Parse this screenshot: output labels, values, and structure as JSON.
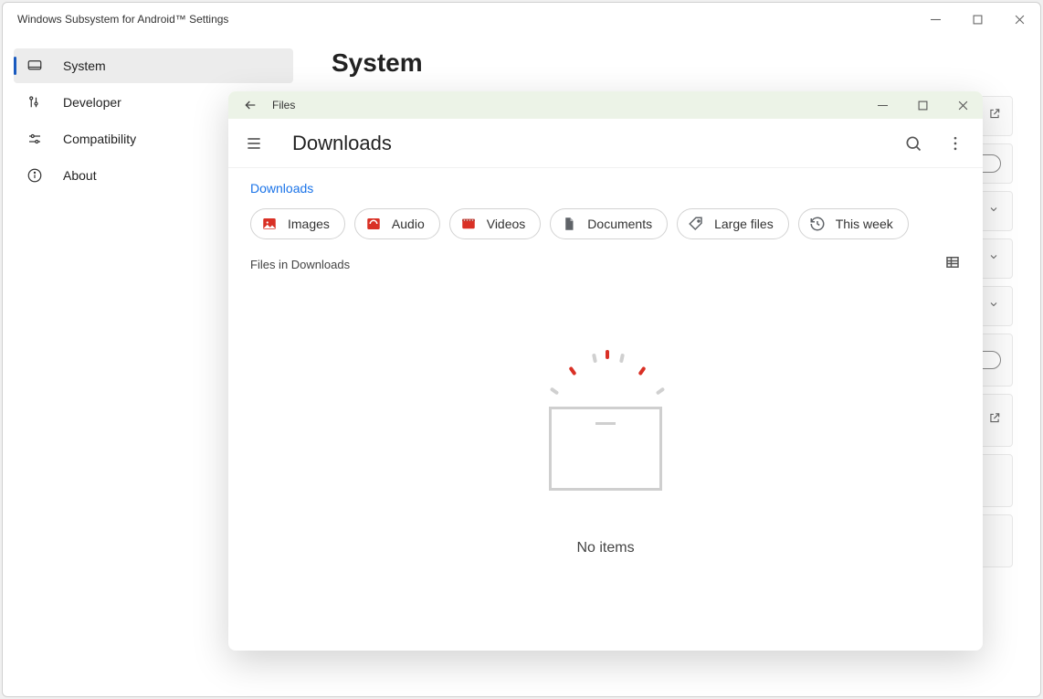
{
  "settings": {
    "title": "Windows Subsystem for Android™ Settings",
    "page_title": "System",
    "nav": [
      {
        "label": "System"
      },
      {
        "label": "Developer"
      },
      {
        "label": "Compatibility"
      },
      {
        "label": "About"
      }
    ]
  },
  "files": {
    "window_title": "Files",
    "heading": "Downloads",
    "breadcrumb": "Downloads",
    "subheader": "Files in Downloads",
    "empty_label": "No items",
    "chips": [
      {
        "label": "Images"
      },
      {
        "label": "Audio"
      },
      {
        "label": "Videos"
      },
      {
        "label": "Documents"
      },
      {
        "label": "Large files"
      },
      {
        "label": "This week"
      }
    ]
  }
}
